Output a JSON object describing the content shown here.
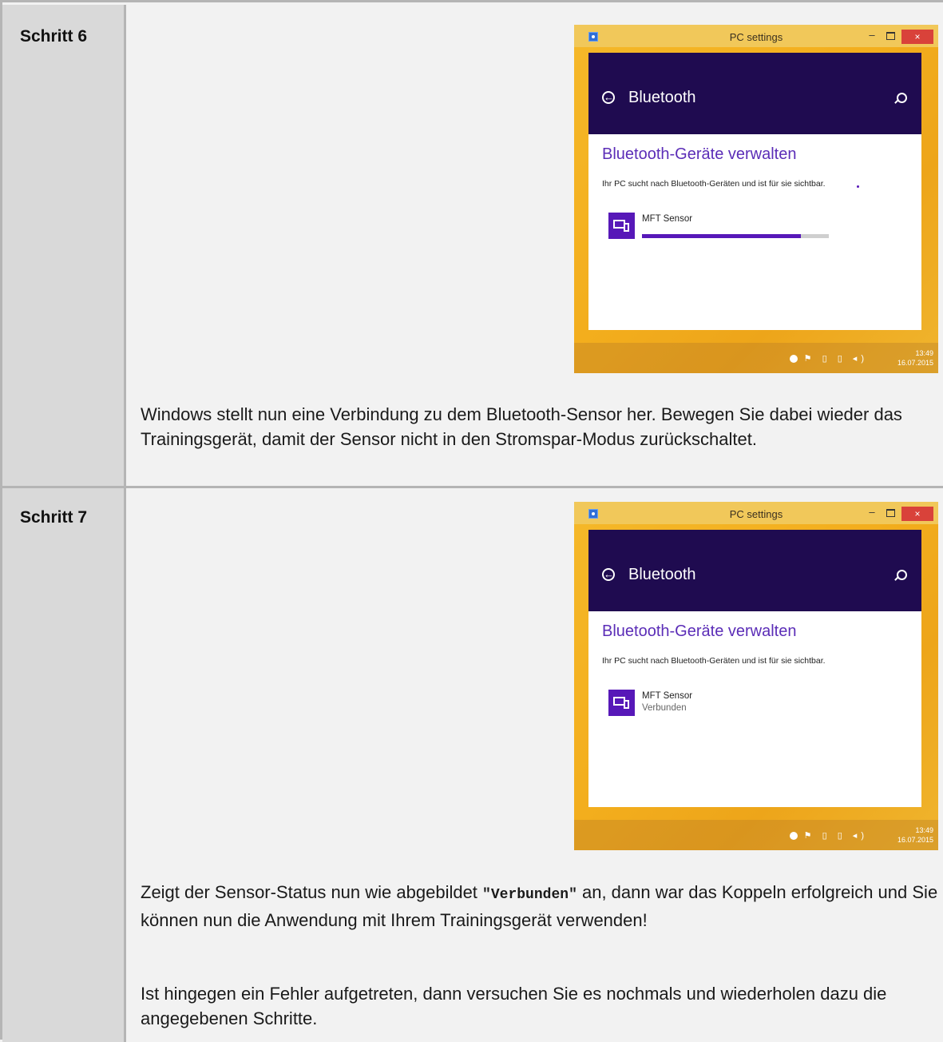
{
  "steps": [
    {
      "label": "Schritt 6",
      "screenshot": {
        "window_title": "PC settings",
        "min_symbol": "–",
        "close_symbol": "×",
        "back_symbol": "←",
        "header_title": "Bluetooth",
        "heading": "Bluetooth-Geräte verwalten",
        "description": "Ihr PC sucht nach Bluetooth-Geräten und ist für sie sichtbar.",
        "device_name": "MFT Sensor",
        "device_status": "",
        "pairing_progress": 0.85,
        "tray_icons": "⚑ ▯ ▯ ◂)",
        "time": "13:49",
        "date": "16.07.2015"
      },
      "paragraph_1": "Windows stellt nun eine Verbindung zu dem Bluetooth-Sensor her. Bewegen Sie dabei wieder das Trainingsgerät, damit der Sensor nicht in den Stromspar-Modus zurückschaltet."
    },
    {
      "label": "Schritt 7",
      "screenshot": {
        "window_title": "PC settings",
        "min_symbol": "–",
        "close_symbol": "×",
        "back_symbol": "←",
        "header_title": "Bluetooth",
        "heading": "Bluetooth-Geräte verwalten",
        "description": "Ihr PC sucht nach Bluetooth-Geräten und ist für sie sichtbar.",
        "device_name": "MFT Sensor",
        "device_status": "Verbunden",
        "tray_icons": "⚑ ▯ ▯ ◂)",
        "time": "13:49",
        "date": "16.07.2015"
      },
      "paragraph_1_before": "Zeigt der Sensor-Status nun wie abgebildet ",
      "paragraph_1_code": "\"Verbunden\"",
      "paragraph_1_after": " an, dann war das Koppeln erfolgreich und Sie können nun die Anwendung mit Ihrem Trainingsgerät verwenden!",
      "paragraph_2": "Ist hingegen ein Fehler aufgetreten, dann versuchen Sie es nochmals und wiederholen dazu die angegebenen Schritte."
    }
  ],
  "colors": {
    "accent": "#5718b8",
    "header": "#1f0b50",
    "window_frame": "#f3ae1d",
    "close": "#d9423a"
  }
}
